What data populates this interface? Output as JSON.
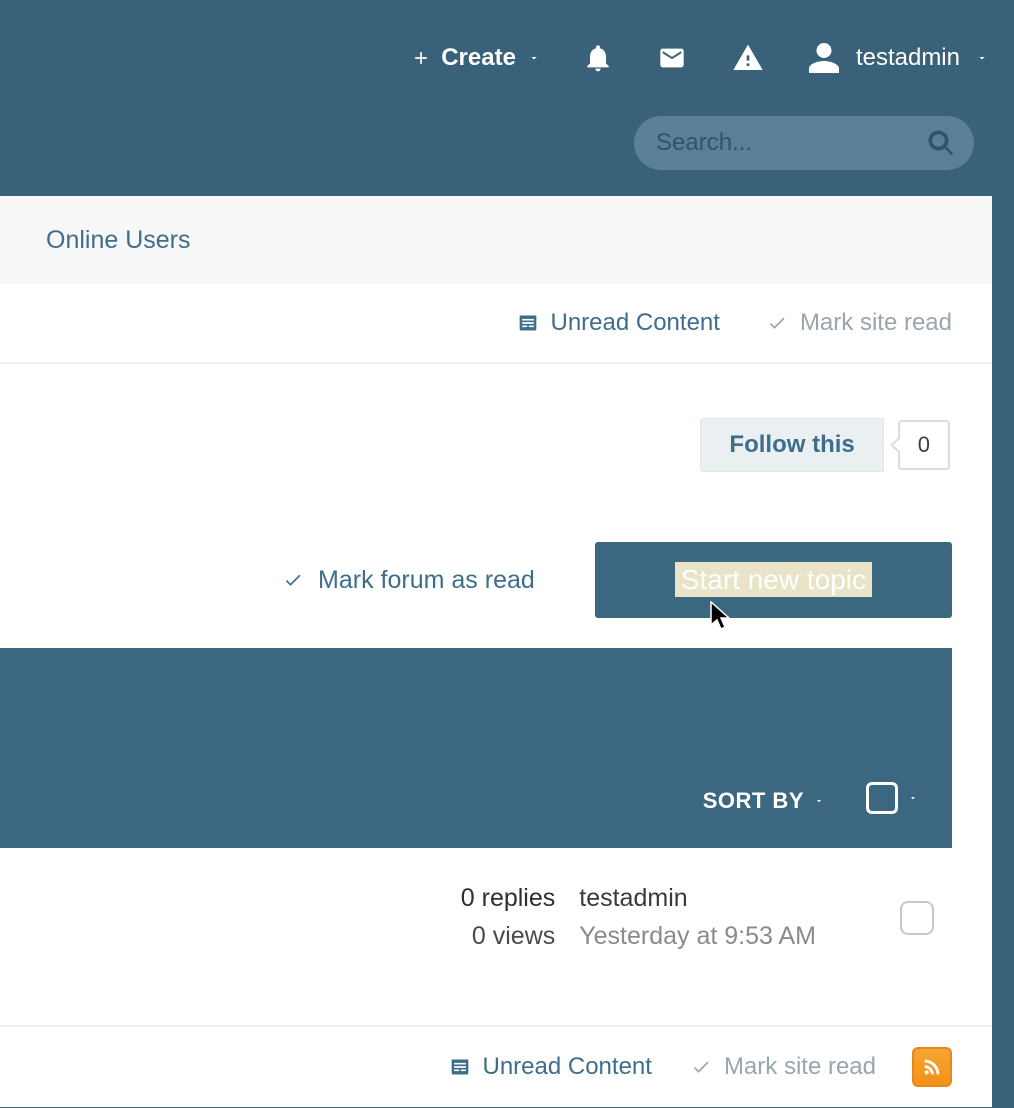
{
  "header": {
    "create_label": "Create",
    "username": "testadmin"
  },
  "search": {
    "placeholder": "Search..."
  },
  "tabs": {
    "online_users": "Online Users"
  },
  "util": {
    "unread_label": "Unread Content",
    "mark_site_label": "Mark site read"
  },
  "follow": {
    "label": "Follow this",
    "count": "0"
  },
  "actions": {
    "mark_forum_label": "Mark forum as read",
    "start_topic_label": "Start new topic"
  },
  "sort": {
    "label": "SORT BY"
  },
  "topic": {
    "replies_label": "0 replies",
    "views_label": "0 views",
    "author": "testadmin",
    "time": "Yesterday at 9:53 AM"
  }
}
